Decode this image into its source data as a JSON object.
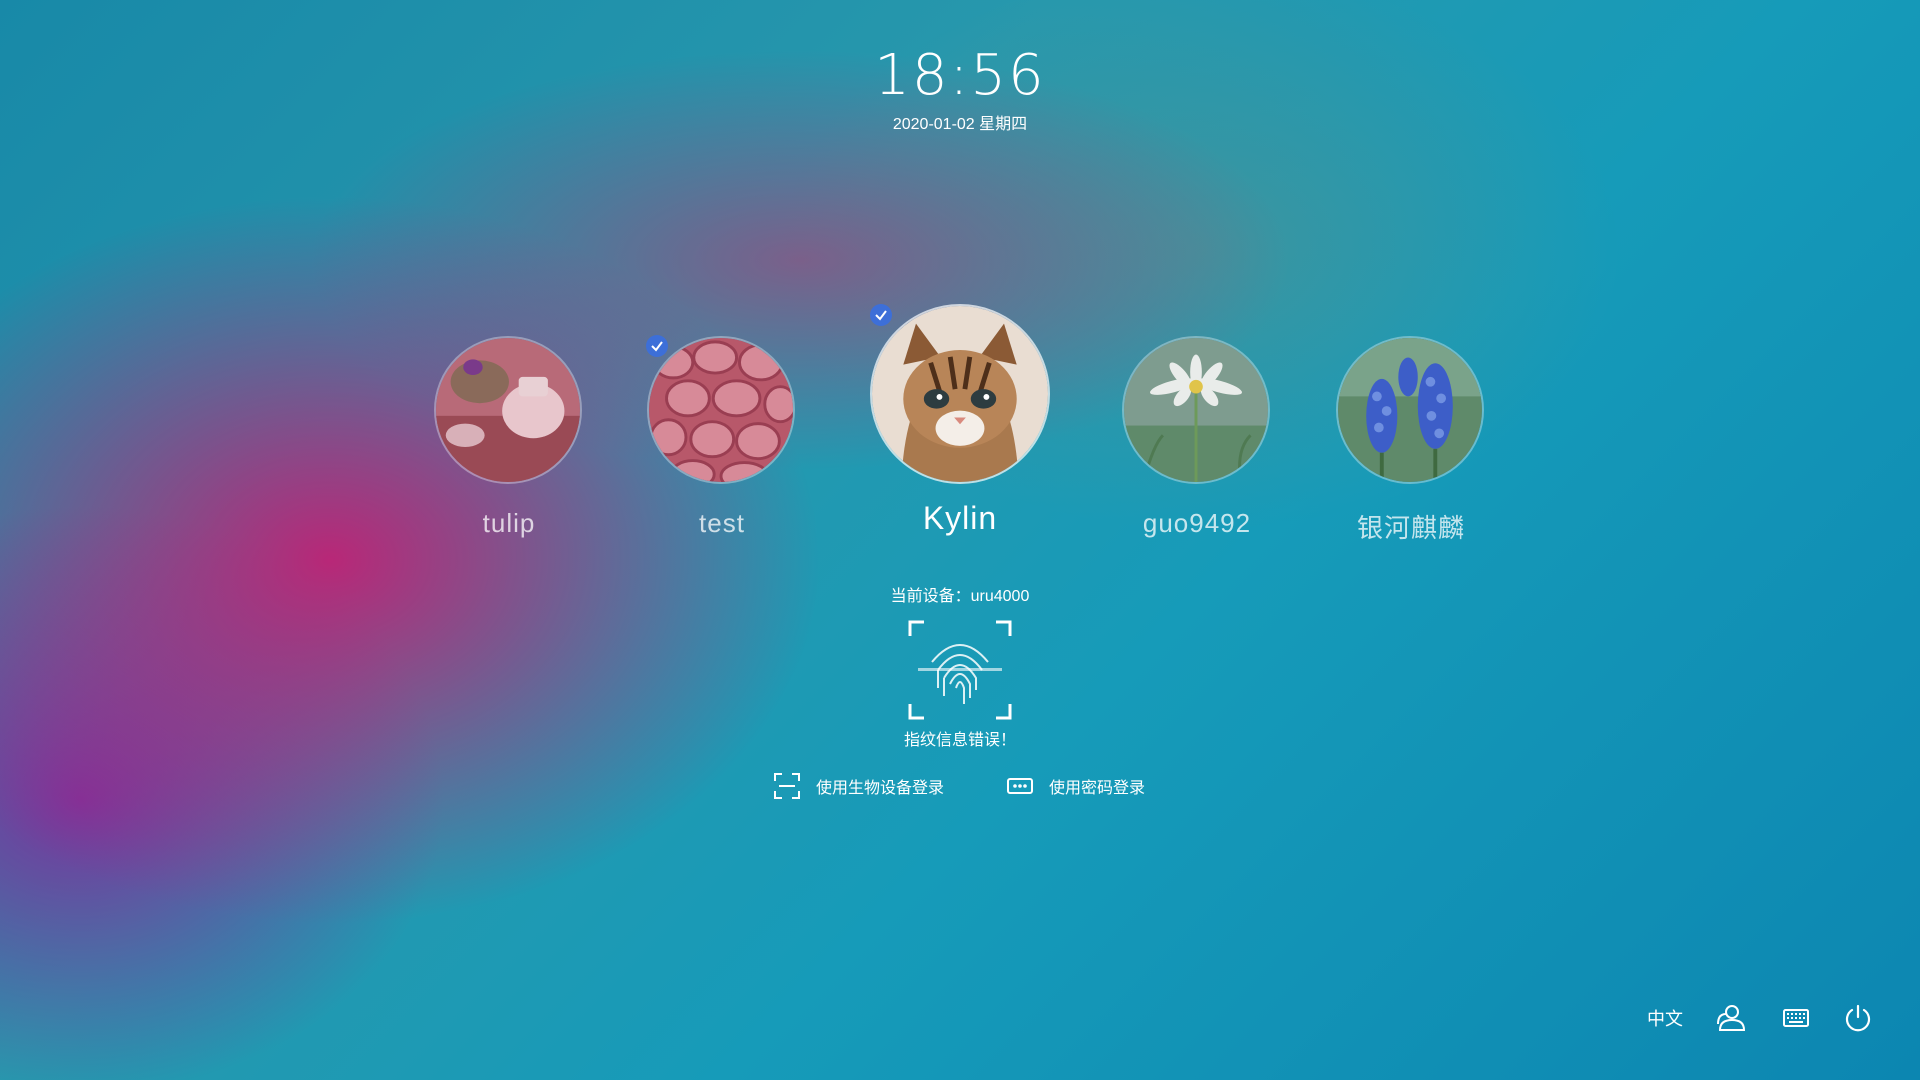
{
  "clock": {
    "time": "18:56",
    "date": "2020-01-02 星期四"
  },
  "users": [
    {
      "name": "tulip",
      "checked": false
    },
    {
      "name": "test",
      "checked": true
    },
    {
      "name": "Kylin",
      "checked": true,
      "current": true
    },
    {
      "name": "guo9492",
      "checked": false
    },
    {
      "name": "银河麒麟",
      "checked": false
    }
  ],
  "auth": {
    "device_text": "当前设备：uru4000",
    "error_text": "指纹信息错误！",
    "biometric_login_label": "使用生物设备登录",
    "password_login_label": "使用密码登录"
  },
  "tray": {
    "language_label": "中文",
    "icons": [
      "user-switch-icon",
      "keyboard-icon",
      "power-icon"
    ]
  },
  "colors": {
    "check_badge": "#3d6fd8"
  }
}
